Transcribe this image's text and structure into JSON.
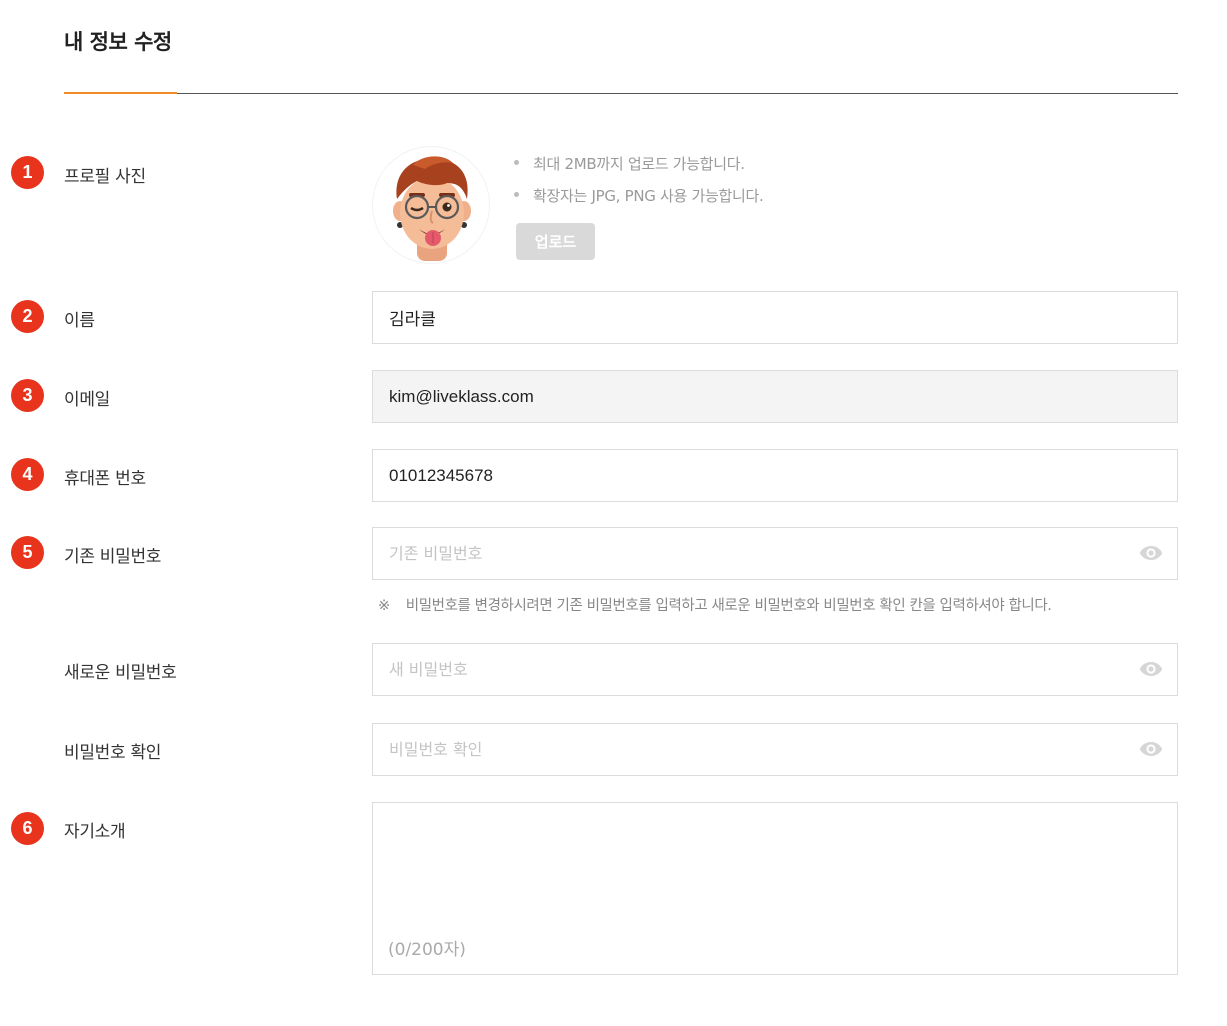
{
  "page": {
    "title": "내 정보 수정"
  },
  "colors": {
    "accent": "#f08a24",
    "badge": "#e8341c",
    "upload_disabled": "#d9d9d9"
  },
  "fields": {
    "profile_photo": {
      "badge": "1",
      "label": "프로필 사진",
      "hints": [
        "최대 2MB까지 업로드 가능합니다.",
        "확장자는 JPG, PNG 사용 가능합니다."
      ],
      "upload_label": "업로드",
      "avatar_icon": "memoji-avatar-icon"
    },
    "name": {
      "badge": "2",
      "label": "이름",
      "value": "김라클"
    },
    "email": {
      "badge": "3",
      "label": "이메일",
      "value": "kim@liveklass.com"
    },
    "phone": {
      "badge": "4",
      "label": "휴대폰 번호",
      "value": "01012345678"
    },
    "current_password": {
      "badge": "5",
      "label": "기존 비밀번호",
      "placeholder": "기존 비밀번호",
      "icon": "eye-icon"
    },
    "password_notice": {
      "mark": "※",
      "text": "비밀번호를 변경하시려면 기존 비밀번호를 입력하고 새로운 비밀번호와 비밀번호 확인 칸을 입력하셔야 합니다."
    },
    "new_password": {
      "label": "새로운 비밀번호",
      "placeholder": "새 비밀번호",
      "icon": "eye-icon"
    },
    "confirm_password": {
      "label": "비밀번호 확인",
      "placeholder": "비밀번호 확인",
      "icon": "eye-icon"
    },
    "bio": {
      "badge": "6",
      "label": "자기소개",
      "value": "",
      "counter": "(0/200자)"
    }
  }
}
